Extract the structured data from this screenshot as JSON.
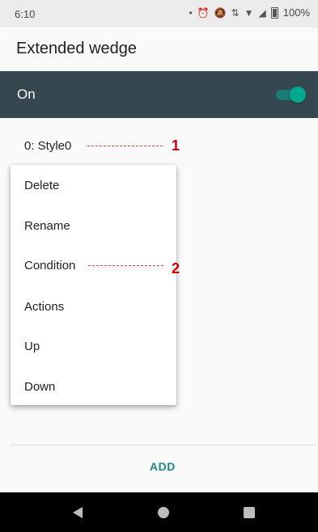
{
  "status_bar": {
    "time": "6:10",
    "battery": "100%",
    "icons": [
      "dot-icon",
      "alarm-icon",
      "mute-icon",
      "data-arrows-icon",
      "wifi-icon",
      "signal-icon",
      "battery-icon"
    ]
  },
  "app_bar": {
    "title": "Extended wedge"
  },
  "toggle_bar": {
    "label": "On",
    "checked": true,
    "accent": "#00a88f",
    "background": "#37474f"
  },
  "style_list": {
    "items": [
      "0: Style0"
    ]
  },
  "context_menu": {
    "items": [
      "Delete",
      "Rename",
      "Condition",
      "Actions",
      "Up",
      "Down"
    ]
  },
  "annotations": [
    "1",
    "2"
  ],
  "footer": {
    "add_label": "ADD",
    "accent": "#1b8a7e"
  },
  "nav_bar": {
    "buttons": [
      "back-icon",
      "home-icon",
      "recents-icon"
    ]
  }
}
